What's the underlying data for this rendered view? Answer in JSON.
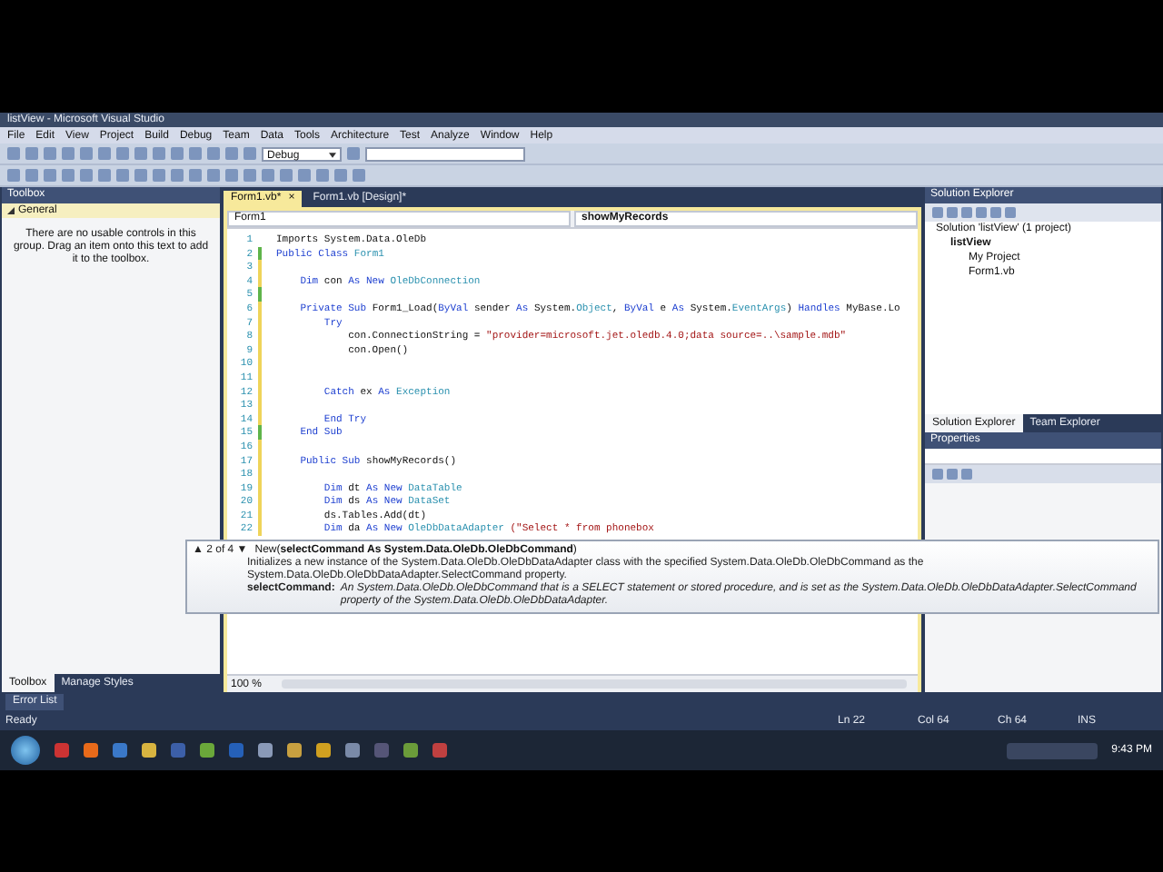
{
  "window": {
    "title": "listView - Microsoft Visual Studio"
  },
  "menu": [
    "File",
    "Edit",
    "View",
    "Project",
    "Build",
    "Debug",
    "Team",
    "Data",
    "Tools",
    "Architecture",
    "Test",
    "Analyze",
    "Window",
    "Help"
  ],
  "toolbar": {
    "configuration": "Debug"
  },
  "toolbox": {
    "title": "Toolbox",
    "group": "General",
    "message": "There are no usable controls in this group. Drag an item onto this text to add it to the toolbox.",
    "tabs": [
      {
        "label": "Toolbox",
        "selected": true
      },
      {
        "label": "Manage Styles",
        "selected": false
      }
    ]
  },
  "editor": {
    "tabs": [
      {
        "label": "Form1.vb*",
        "selected": true,
        "close": "×"
      },
      {
        "label": "Form1.vb [Design]*",
        "selected": false
      }
    ],
    "class_dropdown": "Form1",
    "member_dropdown": "showMyRecords",
    "lines": [
      {
        "number": "1",
        "code": [
          {
            "text": "Imports System.Data.OleDb",
            "kind": "plain"
          }
        ]
      },
      {
        "number": "2",
        "color": "#5fb44a",
        "code": [
          {
            "text": "Public Class ",
            "kind": "kw"
          },
          {
            "text": "Form1",
            "kind": "type"
          }
        ]
      },
      {
        "number": "3",
        "color": "#efd45a"
      },
      {
        "number": "4",
        "color": "#efd45a",
        "code": [
          {
            "text": "    Dim ",
            "kind": "kw"
          },
          {
            "text": "con ",
            "kind": "plain"
          },
          {
            "text": "As New ",
            "kind": "kw"
          },
          {
            "text": "OleDbConnection",
            "kind": "type"
          }
        ]
      },
      {
        "number": "5",
        "color": "#5fb44a"
      },
      {
        "number": "6",
        "color": "#efd45a",
        "code": [
          {
            "text": "    Private Sub ",
            "kind": "kw"
          },
          {
            "text": "Form1_Load(",
            "kind": "plain"
          },
          {
            "text": "ByVal ",
            "kind": "kw"
          },
          {
            "text": "sender ",
            "kind": "plain"
          },
          {
            "text": "As ",
            "kind": "kw"
          },
          {
            "text": "System.",
            "kind": "plain"
          },
          {
            "text": "Object",
            "kind": "type"
          },
          {
            "text": ", ",
            "kind": "plain"
          },
          {
            "text": "ByVal ",
            "kind": "kw"
          },
          {
            "text": "e ",
            "kind": "plain"
          },
          {
            "text": "As ",
            "kind": "kw"
          },
          {
            "text": "System.",
            "kind": "plain"
          },
          {
            "text": "EventArgs",
            "kind": "type"
          },
          {
            "text": ") ",
            "kind": "plain"
          },
          {
            "text": "Handles ",
            "kind": "kw"
          },
          {
            "text": "MyBase.Lo",
            "kind": "plain"
          }
        ]
      },
      {
        "number": "7",
        "color": "#efd45a",
        "code": [
          {
            "text": "        Try",
            "kind": "kw"
          }
        ]
      },
      {
        "number": "8",
        "color": "#efd45a",
        "code": [
          {
            "text": "            con.ConnectionString = ",
            "kind": "plain"
          },
          {
            "text": "\"provider=microsoft.jet.oledb.4.0;data source=..\\sample.mdb\"",
            "kind": "str"
          }
        ]
      },
      {
        "number": "9",
        "color": "#efd45a",
        "code": [
          {
            "text": "            con.Open()",
            "kind": "plain"
          }
        ]
      },
      {
        "number": "10",
        "color": "#efd45a"
      },
      {
        "number": "11",
        "color": "#efd45a"
      },
      {
        "number": "12",
        "color": "#efd45a",
        "code": [
          {
            "text": "        Catch ",
            "kind": "kw"
          },
          {
            "text": "ex ",
            "kind": "plain"
          },
          {
            "text": "As ",
            "kind": "kw"
          },
          {
            "text": "Exception",
            "kind": "type"
          }
        ]
      },
      {
        "number": "13",
        "color": "#efd45a"
      },
      {
        "number": "14",
        "color": "#efd45a",
        "code": [
          {
            "text": "        End Try",
            "kind": "kw"
          }
        ]
      },
      {
        "number": "15",
        "color": "#5fb44a",
        "code": [
          {
            "text": "    End Sub",
            "kind": "kw"
          }
        ]
      },
      {
        "number": "16",
        "color": "#efd45a"
      },
      {
        "number": "17",
        "color": "#efd45a",
        "code": [
          {
            "text": "    Public Sub ",
            "kind": "kw"
          },
          {
            "text": "showMyRecords()",
            "kind": "plain"
          }
        ]
      },
      {
        "number": "18",
        "color": "#efd45a"
      },
      {
        "number": "19",
        "color": "#efd45a",
        "code": [
          {
            "text": "        Dim ",
            "kind": "kw"
          },
          {
            "text": "dt ",
            "kind": "plain"
          },
          {
            "text": "As New ",
            "kind": "kw"
          },
          {
            "text": "DataTable",
            "kind": "type"
          }
        ]
      },
      {
        "number": "20",
        "color": "#efd45a",
        "code": [
          {
            "text": "        Dim ",
            "kind": "kw"
          },
          {
            "text": "ds ",
            "kind": "plain"
          },
          {
            "text": "As New ",
            "kind": "kw"
          },
          {
            "text": "DataSet",
            "kind": "type"
          }
        ]
      },
      {
        "number": "21",
        "color": "#efd45a",
        "code": [
          {
            "text": "        ds.Tables.Add(dt)",
            "kind": "plain"
          }
        ]
      },
      {
        "number": "22",
        "color": "#efd45a",
        "code": [
          {
            "text": "        Dim ",
            "kind": "kw"
          },
          {
            "text": "da ",
            "kind": "plain"
          },
          {
            "text": "As New ",
            "kind": "kw"
          },
          {
            "text": "OleDbDataAdapter ",
            "kind": "type"
          },
          {
            "text": "(\"Select * from phonebox",
            "kind": "str"
          }
        ]
      }
    ],
    "zoom": "100 %"
  },
  "tooltip": {
    "counter": "▲ 2 of 4 ▼",
    "signature": "New(**selectCommand As System.Data.OleDb.OleDbCommand**)",
    "summary": "Initializes a new instance of the System.Data.OleDb.OleDbDataAdapter class with the specified System.Data.OleDb.OleDbCommand as the System.Data.OleDb.OleDbDataAdapter.SelectCommand property.",
    "param_name": "selectCommand:",
    "param_description": "An System.Data.OleDb.OleDbCommand that is a SELECT statement or stored procedure, and is set as the System.Data.OleDb.OleDbDataAdapter.SelectCommand property of the System.Data.OleDb.OleDbDataAdapter."
  },
  "solution_explorer": {
    "title": "Solution Explorer",
    "tree": [
      {
        "label": "Solution 'listView' (1 project)",
        "children": [
          {
            "label": "listView",
            "children": [
              {
                "label": "My Project"
              },
              {
                "label": "Form1.vb"
              }
            ]
          }
        ]
      }
    ],
    "tabs": [
      {
        "label": "Solution Explorer",
        "selected": true
      },
      {
        "label": "Team Explorer",
        "selected": false
      }
    ]
  },
  "properties": {
    "title": "Properties"
  },
  "error_list": {
    "label": "Error List"
  },
  "status_bar": {
    "text": "Ready",
    "line": "Ln 22",
    "column": "Col 64",
    "char": "Ch 64",
    "mode": "INS"
  },
  "taskbar": {
    "clock": "9:43 PM"
  }
}
